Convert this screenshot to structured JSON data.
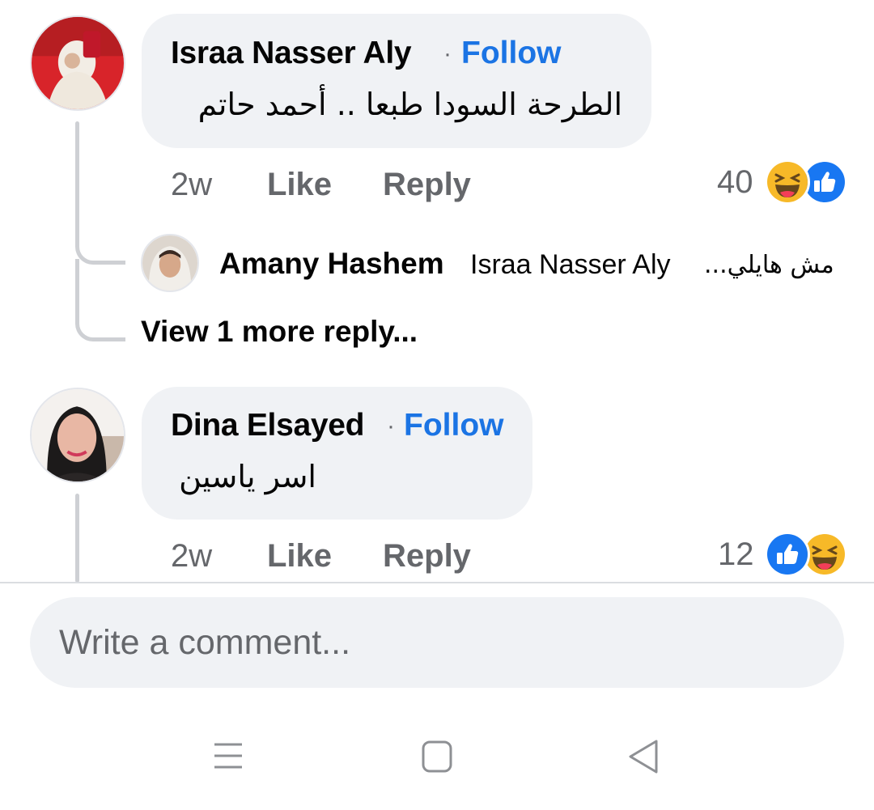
{
  "comments": [
    {
      "author": "Israa Nasser Aly",
      "follow_label": "Follow",
      "separator": "·",
      "text": "الطرحة السودا طبعا .. أحمد حاتم",
      "time": "2w",
      "like_label": "Like",
      "reply_label": "Reply",
      "reaction_count": "40",
      "reactions": [
        "haha-icon",
        "like-icon"
      ],
      "replies": [
        {
          "author": "Amany Hashem",
          "tag": "Israa Nasser Aly",
          "text": "مش هايلي..."
        }
      ],
      "more_replies_label": "View 1 more reply..."
    },
    {
      "author": "Dina Elsayed",
      "follow_label": "Follow",
      "separator": "·",
      "text": "اسر ياسين",
      "time": "2w",
      "like_label": "Like",
      "reply_label": "Reply",
      "reaction_count": "12",
      "reactions": [
        "like-icon",
        "haha-icon"
      ]
    }
  ],
  "composer": {
    "placeholder": "Write a comment..."
  },
  "navbar": {
    "items": [
      "menu-icon",
      "home-icon",
      "back-icon"
    ]
  },
  "colors": {
    "follow_blue": "#1b74e4",
    "bubble_bg": "#f0f2f5",
    "meta_gray": "#65676b",
    "like_blue": "#1877f2",
    "haha_yellow": "#f7b928"
  }
}
